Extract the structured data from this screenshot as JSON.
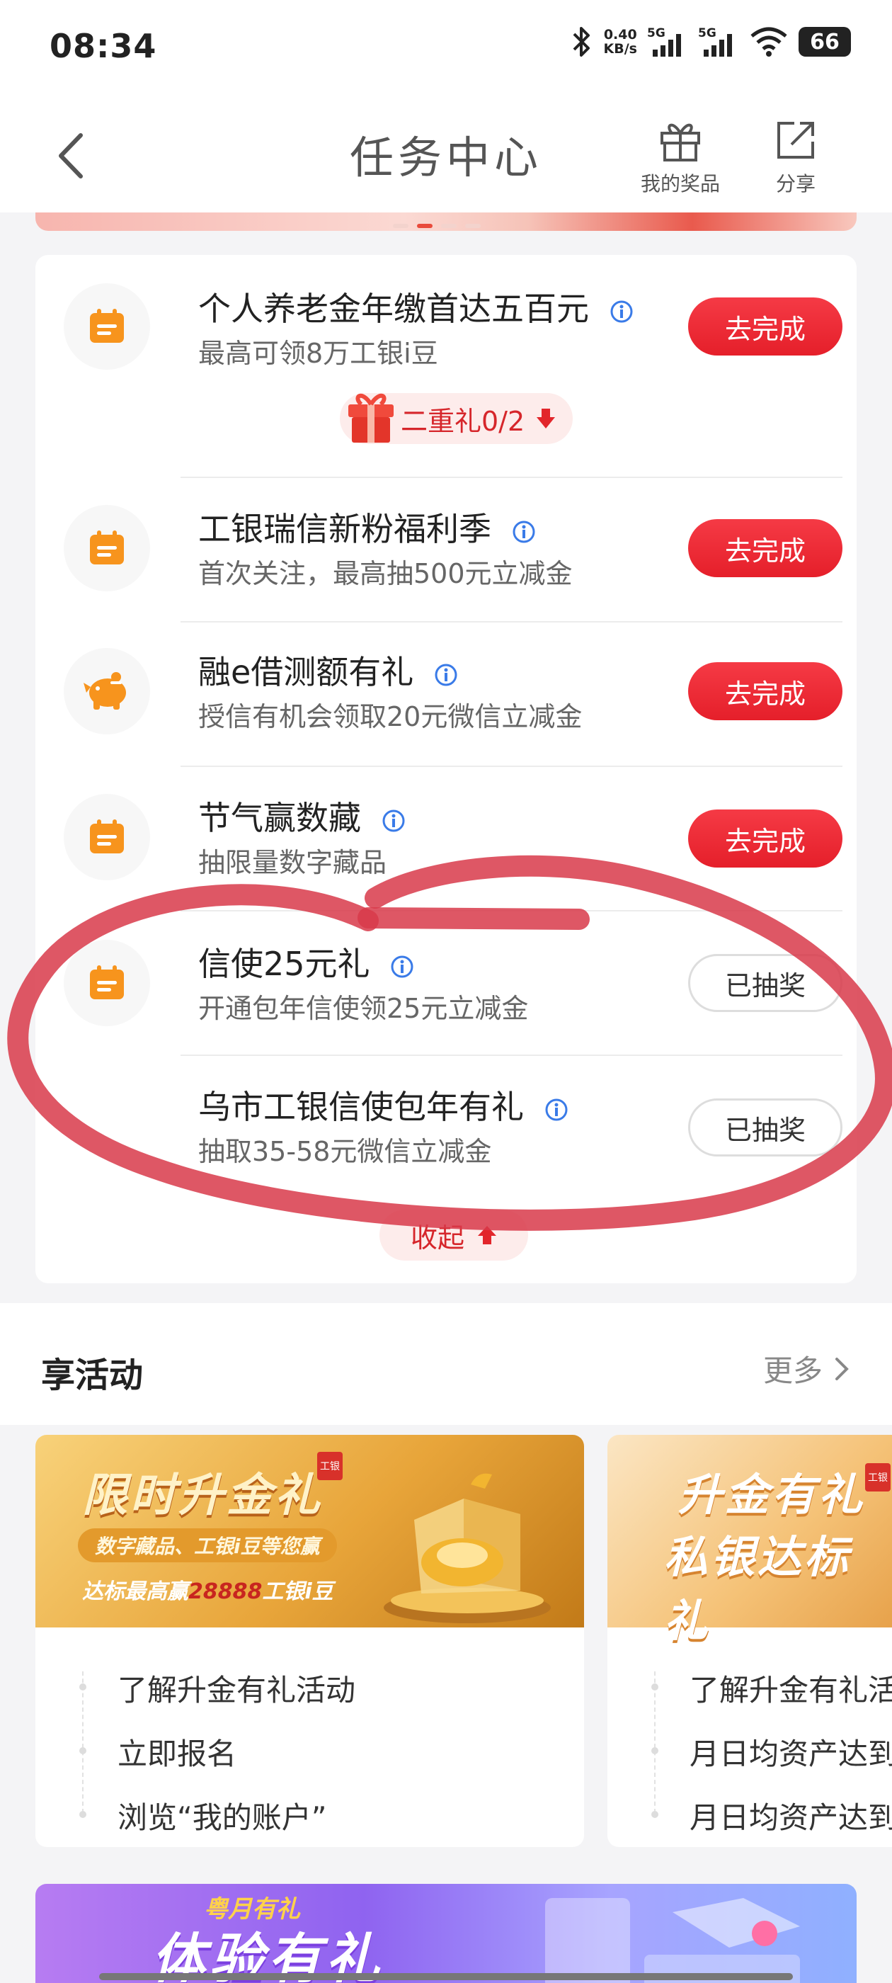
{
  "status_bar": {
    "time": "08:34",
    "net_speed_value": "0.40",
    "net_speed_unit": "KB/s",
    "signal1": "5G",
    "signal2": "5G",
    "battery": "66"
  },
  "header": {
    "title": "任务中心",
    "prizes_label": "我的奖品",
    "share_label": "分享"
  },
  "tasks": [
    {
      "title": "个人养老金年缴首达五百元",
      "subtitle": "最高可领8万工银i豆",
      "button": "去完成",
      "icon": "calendar-icon",
      "state": "todo"
    },
    {
      "title": "工银瑞信新粉福利季",
      "subtitle": "首次关注，最高抽500元立减金",
      "button": "去完成",
      "icon": "calendar-icon",
      "state": "todo"
    },
    {
      "title": "融e借测额有礼",
      "subtitle": "授信有机会领取20元微信立减金",
      "button": "去完成",
      "icon": "piggy-bank-icon",
      "state": "todo"
    },
    {
      "title": "节气赢数藏",
      "subtitle": "抽限量数字藏品",
      "button": "去完成",
      "icon": "calendar-icon",
      "state": "todo"
    },
    {
      "title": "信使25元礼",
      "subtitle": "开通包年信使领25元立减金",
      "button": "已抽奖",
      "icon": "calendar-icon",
      "state": "done"
    },
    {
      "title": "乌市工银信使包年有礼",
      "subtitle": "抽取35-58元微信立减金",
      "button": "已抽奖",
      "icon": "",
      "state": "done"
    }
  ],
  "gift_pill": "二重礼0/2",
  "collapse_label": "收起",
  "activities": {
    "section_title": "享活动",
    "more_label": "更多",
    "cards": [
      {
        "banner_title": "限时升金礼",
        "banner_tag": "数字藏品、工银i豆等您赢",
        "banner_line_prefix": "达标最高赢",
        "banner_line_highlight": "28888",
        "banner_line_suffix": "工银i豆",
        "stamp": "工银",
        "steps": [
          "了解升金有礼活动",
          "立即报名",
          "浏览“我的账户”"
        ]
      },
      {
        "banner_title": "升金有礼",
        "banner_title_line2": "私银达标礼",
        "stamp": "工银",
        "steps": [
          "了解升金有礼活",
          "月日均资产达到",
          "月日均资产达到"
        ]
      }
    ]
  },
  "promo": {
    "small": "粤月有礼",
    "big": "体验有礼"
  },
  "colors": {
    "accent_red": "#e51f2a",
    "icon_orange": "#f7941d",
    "annotation_red": "#d8394a"
  }
}
